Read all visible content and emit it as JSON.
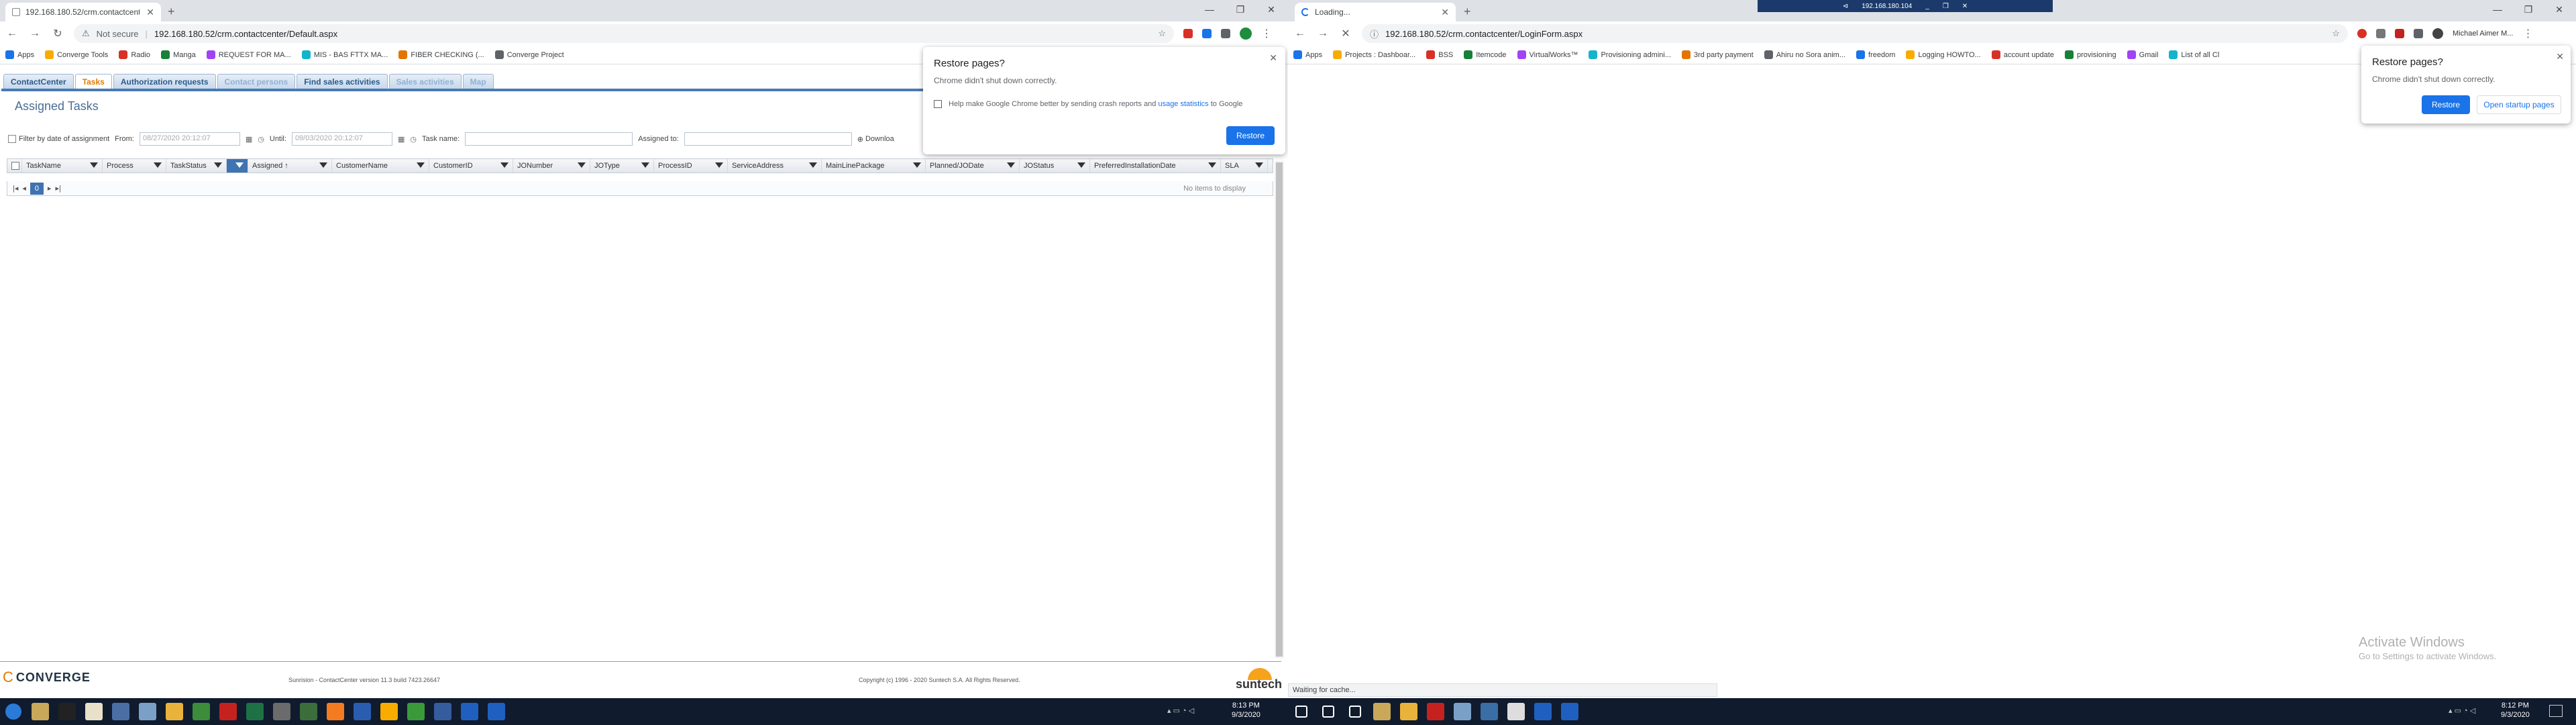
{
  "left": {
    "tab_title": "192.168.180.52/crm.contactcente",
    "not_secure": "Not secure",
    "url": "192.168.180.52/crm.contactcenter/Default.aspx",
    "bookmarks": [
      "Apps",
      "Converge Tools",
      "Radio",
      "Manga",
      "REQUEST FOR MA...",
      "MIS - BAS FTTX MA...",
      "FIBER CHECKING (...",
      "Converge Project"
    ],
    "crm_tabs": [
      "ContactCenter",
      "Tasks",
      "Authorization requests",
      "Contact persons",
      "Find sales activities",
      "Sales activities",
      "Map"
    ],
    "page_title": "Assigned Tasks",
    "filter_label": "Filter by date of assignment",
    "from_label": "From:",
    "from_value": "08/27/2020 20:12:07",
    "until_label": "Until:",
    "until_value": "09/03/2020 20:12:07",
    "task_name_label": "Task name:",
    "assigned_to_label": "Assigned to:",
    "download_label": "Downloa",
    "columns": [
      "TaskName",
      "Process",
      "TaskStatus",
      "",
      "Assigned ↑",
      "CustomerName",
      "CustomerID",
      "JONumber",
      "JOType",
      "ProcessID",
      "ServiceAddress",
      "MainLinePackage",
      "Planned/JODate",
      "JOStatus",
      "PreferredInstallationDate",
      "SLA"
    ],
    "pager_page": "0",
    "no_items": "No items to display",
    "footer_logo": "CONVERGE",
    "footer_version": "Sunrision - ContactCenter version 11.3 build 7423.26647",
    "footer_copyright": "Copyright (c) 1996 - 2020 Suntech S.A. All Rights Reserved.",
    "footer_brand": "suntech",
    "restore_popup": {
      "title": "Restore pages?",
      "message": "Chrome didn't shut down correctly.",
      "checkbox_text_1": "Help make Google Chrome better by sending crash reports and ",
      "checkbox_link": "usage statistics",
      "checkbox_text_2": " to Google",
      "restore_button": "Restore"
    }
  },
  "right": {
    "tab_title": "Loading...",
    "url": "192.168.180.52/crm.contactcenter/LoginForm.aspx",
    "remote_title": "192.168.180.104",
    "profile": "Michael Aimer M...",
    "bookmarks": [
      "Apps",
      "Projects : Dashboar...",
      "BSS",
      "Itemcode",
      "VirtualWorks™",
      "Provisioning admini...",
      "3rd party payment",
      "Ahiru no Sora anim...",
      "freedom",
      "Logging HOWTO...",
      "account update",
      "provisioning",
      "Gmail",
      "List of all Cl"
    ],
    "restore_popup": {
      "title": "Restore pages?",
      "message": "Chrome didn't shut down correctly.",
      "restore_button": "Restore",
      "open_startup_button": "Open startup pages"
    },
    "activate_title": "Activate Windows",
    "activate_sub": "Go to Settings to activate Windows.",
    "status_text": "Waiting for cache..."
  },
  "taskbar": {
    "left_time": "8:13 PM",
    "left_date": "9/3/2020",
    "right_time": "8:12 PM",
    "right_date": "9/3/2020"
  }
}
